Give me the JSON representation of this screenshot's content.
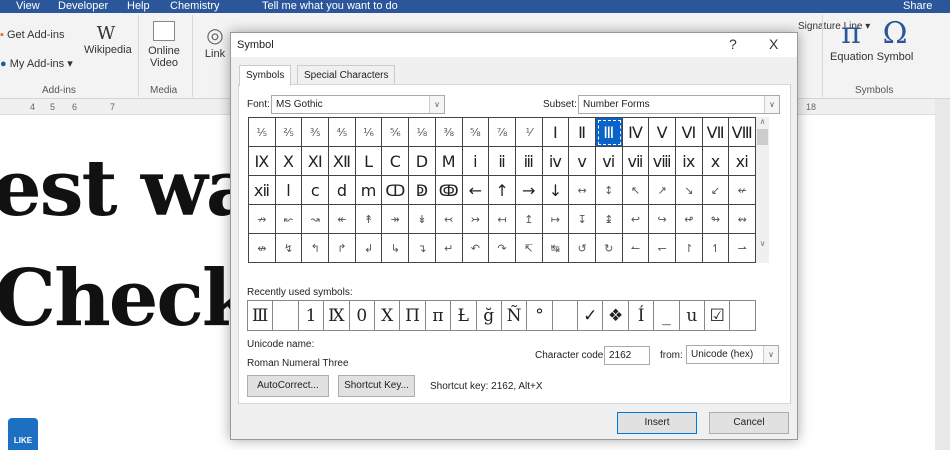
{
  "menu": [
    "View",
    "Developer",
    "Help",
    "Chemistry",
    "Tell me what you want to do"
  ],
  "share": "Share",
  "ribbon": {
    "get_addins": "Get Add-ins",
    "my_addins": "My Add-ins",
    "wikipedia": "Wikipedia",
    "online_video": "Online Video",
    "link": "Link",
    "signature_line": "Signature Line",
    "equation": "Equation",
    "symbol": "Symbol",
    "groups": {
      "addins": "Add-ins",
      "media": "Media",
      "symbols": "Symbols"
    }
  },
  "ruler": [
    "4",
    "5",
    "6",
    "7",
    "18"
  ],
  "document": {
    "line1": "est wa",
    "line2": "Check"
  },
  "like_badge": "LIKE",
  "dialog": {
    "title": "Symbol",
    "help": "?",
    "close": "X",
    "tabs": [
      "Symbols",
      "Special Characters"
    ],
    "font_label": "Font:",
    "font_value": "MS Gothic",
    "subset_label": "Subset:",
    "subset_value": "Number Forms",
    "grid": [
      [
        "⅕",
        "⅖",
        "⅗",
        "⅘",
        "⅙",
        "⅚",
        "⅛",
        "⅜",
        "⅝",
        "⅞",
        "⅟",
        "Ⅰ",
        "Ⅱ",
        "Ⅲ",
        "Ⅳ",
        "Ⅴ",
        "Ⅵ",
        "Ⅶ",
        "Ⅷ"
      ],
      [
        "Ⅸ",
        "Ⅹ",
        "Ⅺ",
        "Ⅻ",
        "Ⅼ",
        "Ⅽ",
        "Ⅾ",
        "Ⅿ",
        "ⅰ",
        "ⅱ",
        "ⅲ",
        "ⅳ",
        "ⅴ",
        "ⅵ",
        "ⅶ",
        "ⅷ",
        "ⅸ",
        "ⅹ",
        "ⅺ"
      ],
      [
        "ⅻ",
        "ⅼ",
        "ⅽ",
        "ⅾ",
        "ⅿ",
        "ↀ",
        "ↁ",
        "ↂ",
        "←",
        "↑",
        "→",
        "↓",
        "↔",
        "↕",
        "↖",
        "↗",
        "↘",
        "↙",
        "↚"
      ],
      [
        "↛",
        "↜",
        "↝",
        "↞",
        "↟",
        "↠",
        "↡",
        "↢",
        "↣",
        "↤",
        "↥",
        "↦",
        "↧",
        "↨",
        "↩",
        "↪",
        "↫",
        "↬",
        "↭"
      ],
      [
        "↮",
        "↯",
        "↰",
        "↱",
        "↲",
        "↳",
        "↴",
        "↵",
        "↶",
        "↷",
        "↸",
        "↹",
        "↺",
        "↻",
        "↼",
        "↽",
        "↾",
        "↿",
        "⇀"
      ]
    ],
    "selected": {
      "row": 0,
      "col": 13
    },
    "recent_label": "Recently used symbols:",
    "recent": [
      "Ⅲ",
      " ",
      "1",
      "Ⅸ",
      "0",
      "X",
      "Π",
      "π",
      "Ƚ",
      "ğ",
      "Ñ",
      "°",
      " ",
      "✓",
      "❖",
      "Í",
      "_",
      "u",
      "☑",
      ""
    ],
    "unicode_name_label": "Unicode name:",
    "unicode_name": "Roman Numeral Three",
    "char_code_label": "Character code:",
    "char_code": "2162",
    "from_label": "from:",
    "from_value": "Unicode (hex)",
    "autocorrect": "AutoCorrect...",
    "shortcut_key": "Shortcut Key...",
    "shortcut_text": "Shortcut key: 2162, Alt+X",
    "insert": "Insert",
    "cancel": "Cancel"
  },
  "colors": {
    "title_bar": "#2b579a",
    "selection": "#0a64c8"
  }
}
